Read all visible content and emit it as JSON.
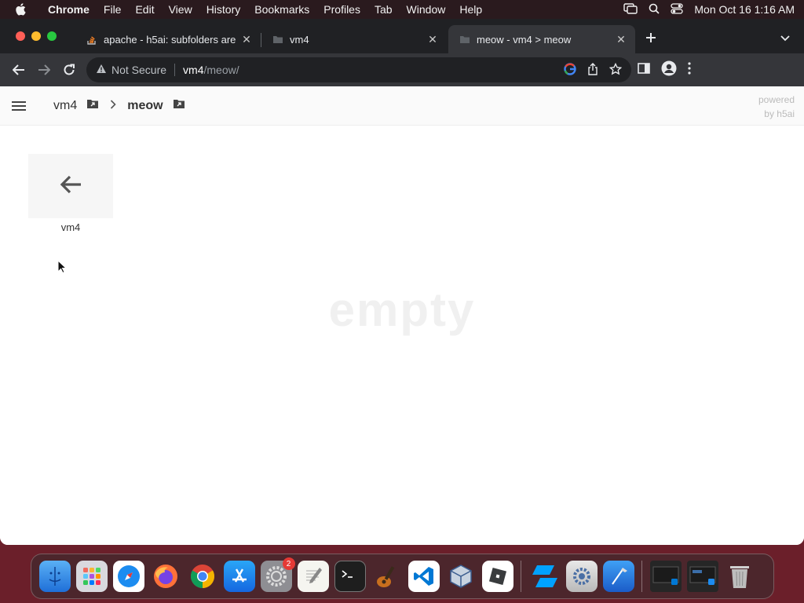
{
  "menubar": {
    "app": "Chrome",
    "items": [
      "File",
      "Edit",
      "View",
      "History",
      "Bookmarks",
      "Profiles",
      "Tab",
      "Window",
      "Help"
    ],
    "clock": "Mon Oct 16  1:16 AM"
  },
  "tabs": [
    {
      "title": "apache - h5ai: subfolders are",
      "icon": "stackoverflow-icon"
    },
    {
      "title": "vm4",
      "icon": "folder-icon"
    },
    {
      "title": "meow - vm4 > meow",
      "icon": "folder-icon",
      "active": true
    }
  ],
  "omnibox": {
    "security": "Not Secure",
    "host": "vm4",
    "path": "/meow/"
  },
  "h5ai": {
    "breadcrumb": [
      {
        "label": "vm4"
      },
      {
        "label": "meow",
        "current": true
      }
    ],
    "powered_line1": "powered",
    "powered_line2": "by h5ai",
    "back_label": "vm4",
    "empty_text": "empty"
  },
  "dock": {
    "settings_badge": "2",
    "apps": [
      "finder-icon",
      "launchpad-icon",
      "safari-icon",
      "firefox-icon",
      "chrome-icon",
      "app-store-icon",
      "system-settings-icon",
      "textedit-icon",
      "terminal-icon",
      "garageband-icon",
      "vscode-icon",
      "virtualbox-icon",
      "roblox-icon",
      "roblox-studio-icon",
      "utility-icon",
      "xcode-icon",
      "window-thumbnail-icon",
      "window-thumbnail-icon",
      "trash-icon"
    ]
  },
  "colors": {
    "accent_red": "#ff5f57",
    "accent_yellow": "#febc2e",
    "accent_green": "#28c840"
  }
}
